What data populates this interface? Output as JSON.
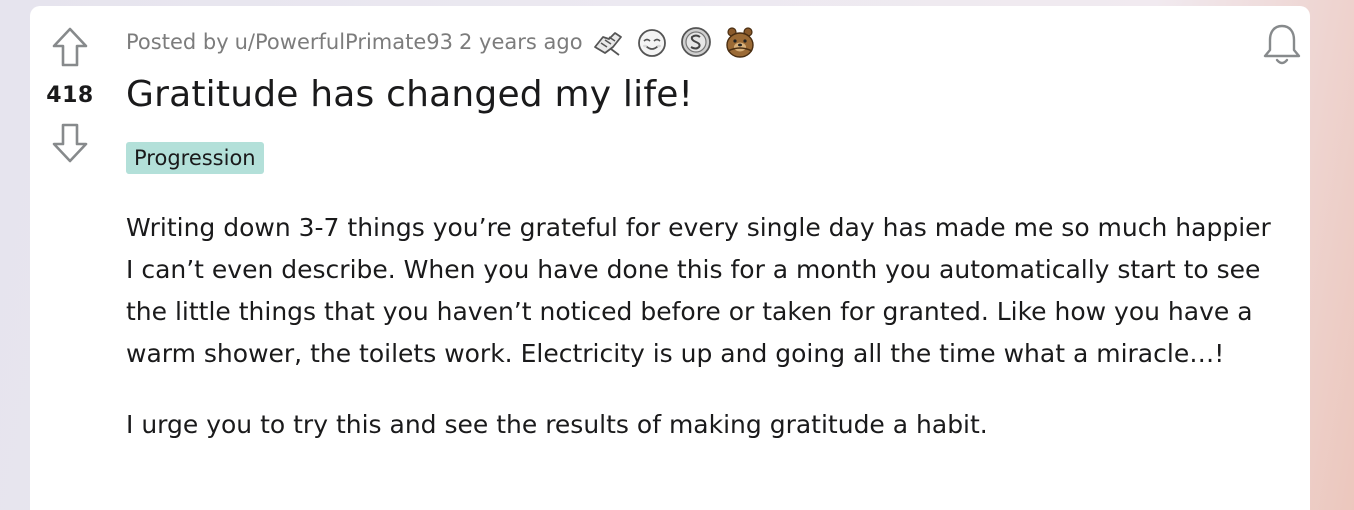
{
  "post": {
    "score": "418",
    "meta": {
      "prefix": "Posted by",
      "author": "u/PowerfulPrimate93",
      "time": "2 years ago"
    },
    "awards": [
      {
        "icon": "helpful-hands-award-icon"
      },
      {
        "icon": "wholesome-face-award-icon"
      },
      {
        "icon": "silver-coin-award-icon"
      },
      {
        "icon": "bear-hug-award-icon"
      }
    ],
    "title": "Gratitude has changed my life!",
    "flair": "Progression",
    "paragraphs": [
      "Writing down 3-7 things you’re grateful for every single day has made me so much happier I can’t even describe. When you have done this for a month you automatically start to see the little things that you haven’t noticed before or taken for granted. Like how you have a warm shower, the toilets work. Electricity is up and going all the time what a miracle…!",
      "I urge you to try this and see the results of making gratitude a habit."
    ]
  },
  "colors": {
    "flair_bg": "#b3e0d9",
    "text": "#1a1a1b",
    "meta_text": "#7c7c7c",
    "icon_stroke": "#878a8c"
  }
}
